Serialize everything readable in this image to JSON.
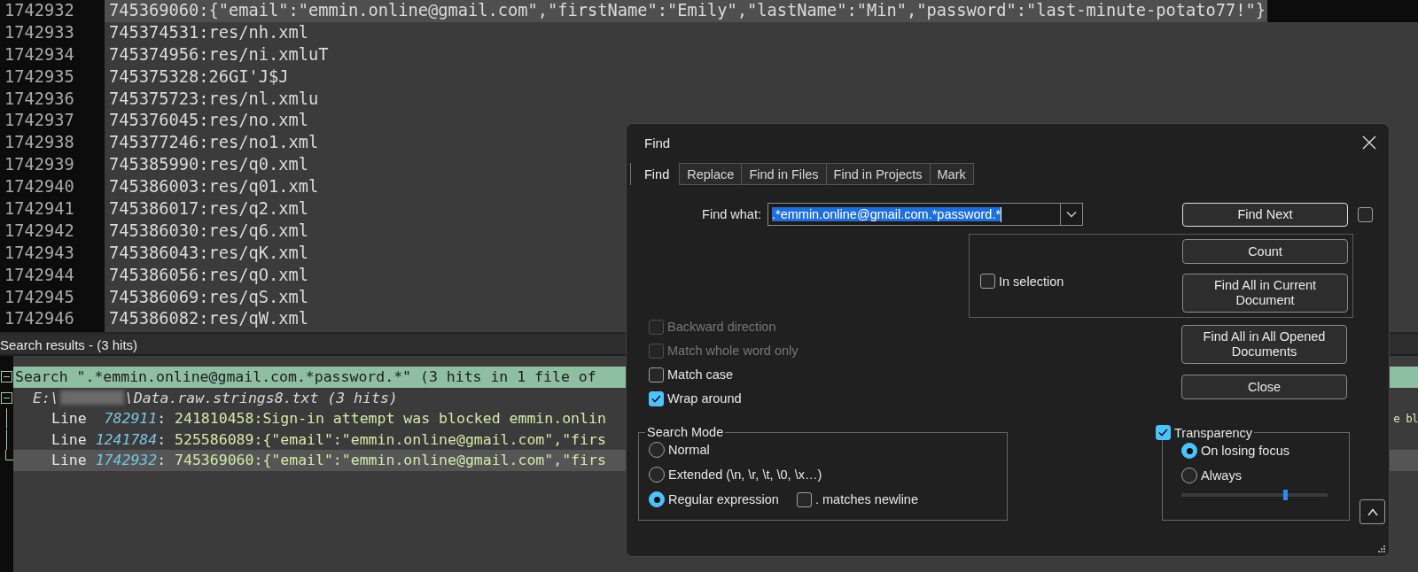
{
  "editor": {
    "lines": [
      {
        "number": "1742932",
        "text": "745369060:{\"email\":\"emmin.online@gmail.com\",\"firstName\":\"Emily\",\"lastName\":\"Min\",\"password\":\"last-minute-potato77!\"}",
        "selected": true
      },
      {
        "number": "1742933",
        "text": "745374531:res/nh.xml",
        "selected": false
      },
      {
        "number": "1742934",
        "text": "745374956:res/ni.xmluT",
        "selected": false
      },
      {
        "number": "1742935",
        "text": "745375328:26GI'J$J",
        "selected": false
      },
      {
        "number": "1742936",
        "text": "745375723:res/nl.xmlu",
        "selected": false
      },
      {
        "number": "1742937",
        "text": "745376045:res/no.xml",
        "selected": false
      },
      {
        "number": "1742938",
        "text": "745377246:res/no1.xml",
        "selected": false
      },
      {
        "number": "1742939",
        "text": "745385990:res/q0.xml",
        "selected": false
      },
      {
        "number": "1742940",
        "text": "745386003:res/q01.xml",
        "selected": false
      },
      {
        "number": "1742941",
        "text": "745386017:res/q2.xml",
        "selected": false
      },
      {
        "number": "1742942",
        "text": "745386030:res/q6.xml",
        "selected": false
      },
      {
        "number": "1742943",
        "text": "745386043:res/qK.xml",
        "selected": false
      },
      {
        "number": "1742944",
        "text": "745386056:res/qO.xml",
        "selected": false
      },
      {
        "number": "1742945",
        "text": "745386069:res/qS.xml",
        "selected": false
      },
      {
        "number": "1742946",
        "text": "745386082:res/qW.xml",
        "selected": false
      }
    ]
  },
  "search_results": {
    "title": "Search results - (3 hits)",
    "query": {
      "text": "Search \".*emmin.online@gmail.com.*password.*\" (3 hits in 1 file of",
      "expanded": true
    },
    "file": {
      "drive": "E:\\",
      "path": "\\Data.raw.strings8.txt (3 hits)",
      "expanded": true
    },
    "hits": [
      {
        "label": "Line",
        "number": "782911",
        "separator": ":",
        "text": "241810458:Sign-in attempt was blocked emmin.onlin",
        "tail": "e bl",
        "selected": false
      },
      {
        "label": "Line",
        "number": "1241784",
        "separator": ":",
        "text": "525586089:{\"email\":\"emmin.online@gmail.com\",\"firs",
        "selected": false
      },
      {
        "label": "Line",
        "number": "1742932",
        "separator": ":",
        "text": "745369060:{\"email\":\"emmin.online@gmail.com\",\"firs",
        "selected": true
      }
    ]
  },
  "find_dialog": {
    "title": "Find",
    "tabs": [
      {
        "label": "Find",
        "selected": true
      },
      {
        "label": "Replace",
        "selected": false
      },
      {
        "label": "Find in Files",
        "selected": false
      },
      {
        "label": "Find in Projects",
        "selected": false
      },
      {
        "label": "Mark",
        "selected": false
      }
    ],
    "find_what": {
      "label": "Find what:",
      "value": ".*emmin.online@gmail.com.*password.*"
    },
    "find_next": "Find Next",
    "extra_checkbox": {
      "checked": false
    },
    "in_selection": {
      "label": "In selection",
      "checked": false
    },
    "selection_buttons": [
      "Count",
      "Find All in Current Document"
    ],
    "options": [
      {
        "label": "Backward direction",
        "checked": false,
        "disabled": true
      },
      {
        "label": "Match whole word only",
        "checked": false,
        "disabled": true
      },
      {
        "label": "Match case",
        "checked": false,
        "disabled": false
      },
      {
        "label": "Wrap around",
        "checked": true,
        "disabled": false
      }
    ],
    "side_buttons": [
      "Find All in All Opened Documents",
      "Close"
    ],
    "search_mode": {
      "title": "Search Mode",
      "modes": [
        {
          "label": "Normal",
          "selected": false
        },
        {
          "label": "Extended (\\n, \\r, \\t, \\0, \\x…)",
          "selected": false
        },
        {
          "label": "Regular expression",
          "selected": true
        }
      ],
      "matches_newline": {
        "label": ". matches newline",
        "checked": false
      }
    },
    "transparency": {
      "label": "Transparency",
      "checked": true,
      "modes": [
        {
          "label": "On losing focus",
          "selected": true
        },
        {
          "label": "Always",
          "selected": false
        }
      ],
      "level": 0.71
    }
  }
}
